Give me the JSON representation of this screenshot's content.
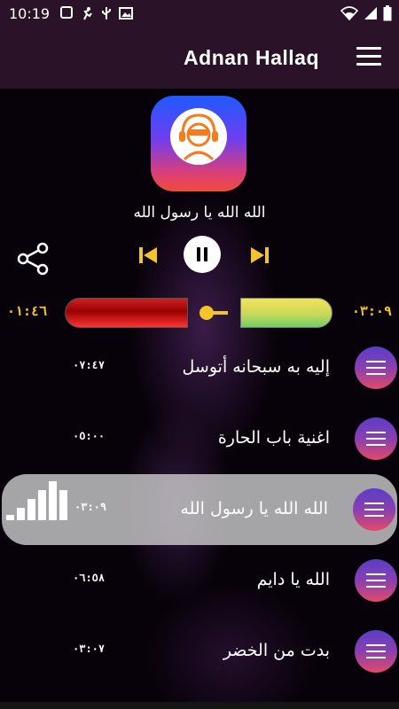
{
  "status_bar": {
    "time": "10:19",
    "icons": [
      "notification-icon",
      "running-icon",
      "usb-icon",
      "image-icon",
      "wifi-icon",
      "signal-icon",
      "battery-icon"
    ]
  },
  "app_bar": {
    "title": "Adnan Hallaq",
    "menu_icon": "hamburger-icon",
    "background": "#2a1228"
  },
  "player": {
    "now_playing_title": "الله الله يا رسول الله",
    "elapsed": "٠٣:٠٩",
    "total": "٠١:٤٦",
    "progress_fraction": 0.5,
    "accent": "#f4c52a",
    "controls": {
      "share_icon": "share-icon",
      "prev_icon": "skip-previous-icon",
      "pause_icon": "pause-icon",
      "next_icon": "skip-next-icon"
    }
  },
  "playlist": [
    {
      "title": "إليه به سبحانه أتوسل",
      "duration": "٠٧:٤٧",
      "active": false
    },
    {
      "title": "اغنية باب الحارة",
      "duration": "٠٥:٠٠",
      "active": false
    },
    {
      "title": "الله الله يا رسول الله",
      "duration": "٠٣:٠٩",
      "active": true
    },
    {
      "title": "الله يا دايم",
      "duration": "٠٦:٥٨",
      "active": false
    },
    {
      "title": "بدت من الخضر",
      "duration": "٠٣:٠٧",
      "active": false
    }
  ]
}
